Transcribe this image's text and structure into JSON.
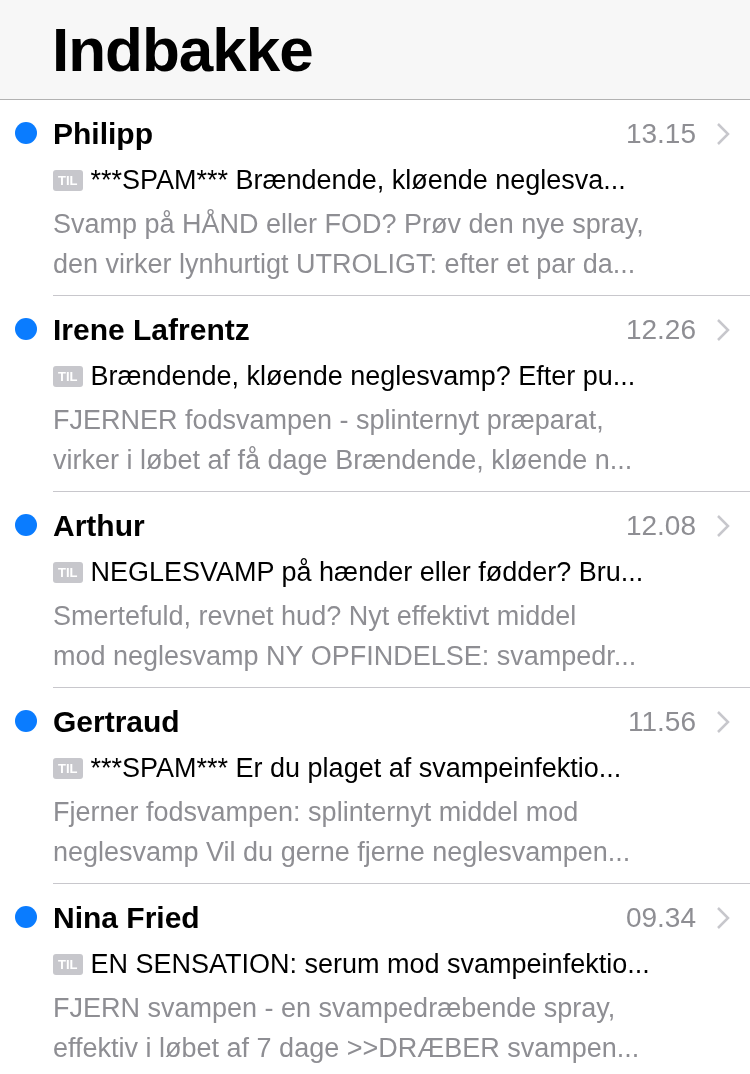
{
  "header": {
    "title": "Indbakke"
  },
  "messages": [
    {
      "sender": "Philipp",
      "time": "13.15",
      "unread": true,
      "tag": "TIL",
      "subject": "***SPAM*** Brændende, kløende neglesva...",
      "preview_lines": [
        "Svamp på HÅND eller FOD? Prøv den nye spray,",
        "den virker lynhurtigt UTROLIGT: efter et par da..."
      ]
    },
    {
      "sender": "Irene Lafrentz",
      "time": "12.26",
      "unread": true,
      "tag": "TIL",
      "subject": "Brændende, kløende neglesvamp? Efter pu...",
      "preview_lines": [
        "FJERNER fodsvampen - splinternyt præparat,",
        "virker i løbet af få dage Brændende, kløende n..."
      ]
    },
    {
      "sender": "Arthur",
      "time": "12.08",
      "unread": true,
      "tag": "TIL",
      "subject": "NEGLESVAMP på hænder eller fødder? Bru...",
      "preview_lines": [
        "Smertefuld, revnet hud? Nyt effektivt middel",
        "mod neglesvamp NY OPFINDELSE: svampedr..."
      ]
    },
    {
      "sender": "Gertraud",
      "time": "11.56",
      "unread": true,
      "tag": "TIL",
      "subject": "***SPAM*** Er du plaget af svampeinfektio...",
      "preview_lines": [
        "Fjerner fodsvampen: splinternyt middel mod",
        "neglesvamp Vil du gerne fjerne neglesvampen..."
      ]
    },
    {
      "sender": "Nina Fried",
      "time": "09.34",
      "unread": true,
      "tag": "TIL",
      "subject": "EN SENSATION: serum mod svampeinfektio...",
      "preview_lines": [
        "FJERN svampen - en svampedræbende spray,",
        "effektiv i løbet af 7 dage >>DRÆBER svampen..."
      ]
    }
  ]
}
